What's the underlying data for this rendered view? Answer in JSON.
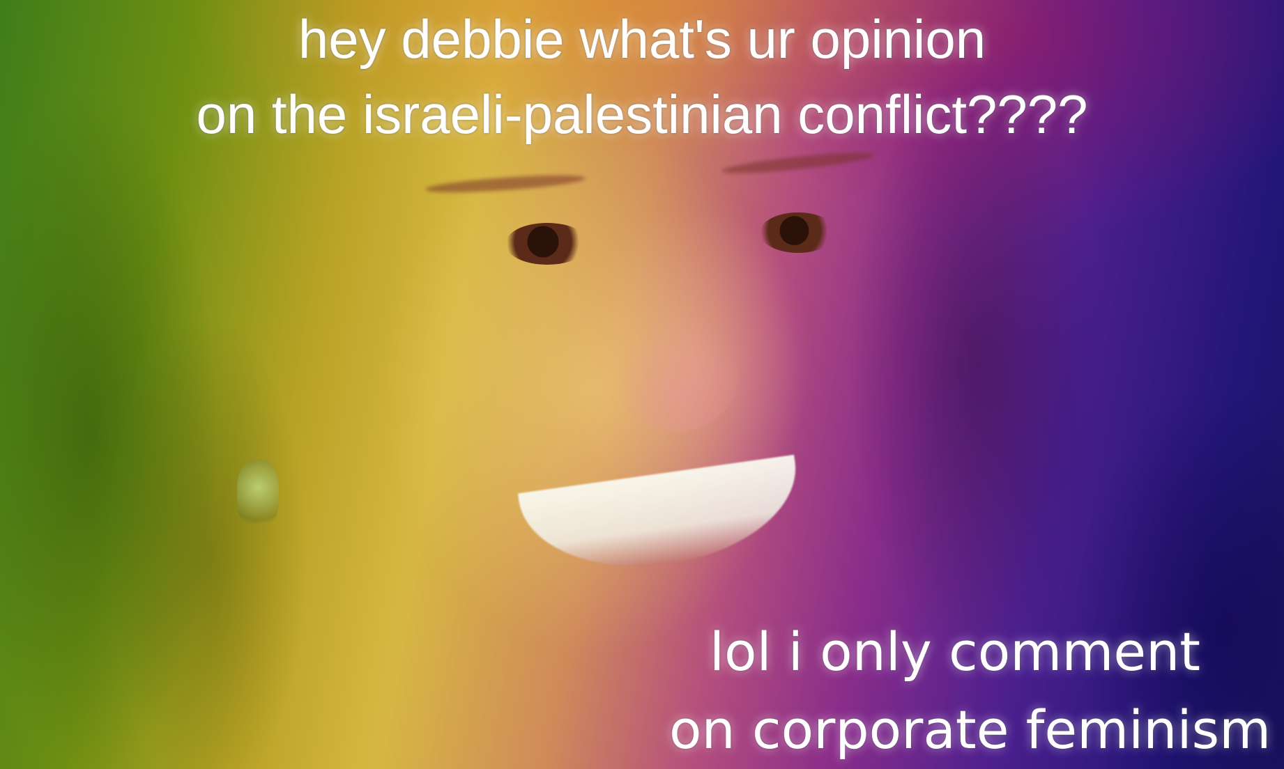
{
  "top_caption": {
    "line1": "hey debbie what's ur opinion",
    "line2": "on the israeli-palestinian conflict????"
  },
  "bottom_caption": {
    "line1": "lol i only comment",
    "line2": "on corporate feminism"
  },
  "colors": {
    "text": "#ffffff",
    "gradient_left": "#3f7d1a",
    "gradient_center": "#d7b743",
    "gradient_right": "#231678"
  }
}
